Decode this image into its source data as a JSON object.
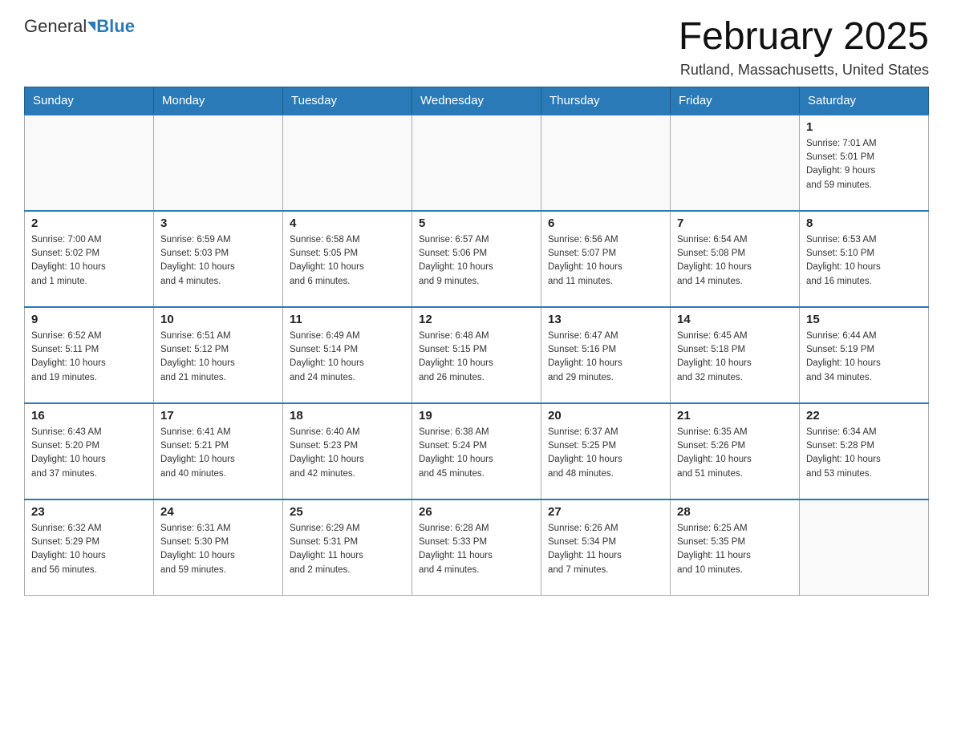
{
  "header": {
    "logo_general": "General",
    "logo_blue": "Blue",
    "month_title": "February 2025",
    "location": "Rutland, Massachusetts, United States"
  },
  "days_of_week": [
    "Sunday",
    "Monday",
    "Tuesday",
    "Wednesday",
    "Thursday",
    "Friday",
    "Saturday"
  ],
  "weeks": [
    [
      {
        "day": "",
        "info": ""
      },
      {
        "day": "",
        "info": ""
      },
      {
        "day": "",
        "info": ""
      },
      {
        "day": "",
        "info": ""
      },
      {
        "day": "",
        "info": ""
      },
      {
        "day": "",
        "info": ""
      },
      {
        "day": "1",
        "info": "Sunrise: 7:01 AM\nSunset: 5:01 PM\nDaylight: 9 hours\nand 59 minutes."
      }
    ],
    [
      {
        "day": "2",
        "info": "Sunrise: 7:00 AM\nSunset: 5:02 PM\nDaylight: 10 hours\nand 1 minute."
      },
      {
        "day": "3",
        "info": "Sunrise: 6:59 AM\nSunset: 5:03 PM\nDaylight: 10 hours\nand 4 minutes."
      },
      {
        "day": "4",
        "info": "Sunrise: 6:58 AM\nSunset: 5:05 PM\nDaylight: 10 hours\nand 6 minutes."
      },
      {
        "day": "5",
        "info": "Sunrise: 6:57 AM\nSunset: 5:06 PM\nDaylight: 10 hours\nand 9 minutes."
      },
      {
        "day": "6",
        "info": "Sunrise: 6:56 AM\nSunset: 5:07 PM\nDaylight: 10 hours\nand 11 minutes."
      },
      {
        "day": "7",
        "info": "Sunrise: 6:54 AM\nSunset: 5:08 PM\nDaylight: 10 hours\nand 14 minutes."
      },
      {
        "day": "8",
        "info": "Sunrise: 6:53 AM\nSunset: 5:10 PM\nDaylight: 10 hours\nand 16 minutes."
      }
    ],
    [
      {
        "day": "9",
        "info": "Sunrise: 6:52 AM\nSunset: 5:11 PM\nDaylight: 10 hours\nand 19 minutes."
      },
      {
        "day": "10",
        "info": "Sunrise: 6:51 AM\nSunset: 5:12 PM\nDaylight: 10 hours\nand 21 minutes."
      },
      {
        "day": "11",
        "info": "Sunrise: 6:49 AM\nSunset: 5:14 PM\nDaylight: 10 hours\nand 24 minutes."
      },
      {
        "day": "12",
        "info": "Sunrise: 6:48 AM\nSunset: 5:15 PM\nDaylight: 10 hours\nand 26 minutes."
      },
      {
        "day": "13",
        "info": "Sunrise: 6:47 AM\nSunset: 5:16 PM\nDaylight: 10 hours\nand 29 minutes."
      },
      {
        "day": "14",
        "info": "Sunrise: 6:45 AM\nSunset: 5:18 PM\nDaylight: 10 hours\nand 32 minutes."
      },
      {
        "day": "15",
        "info": "Sunrise: 6:44 AM\nSunset: 5:19 PM\nDaylight: 10 hours\nand 34 minutes."
      }
    ],
    [
      {
        "day": "16",
        "info": "Sunrise: 6:43 AM\nSunset: 5:20 PM\nDaylight: 10 hours\nand 37 minutes."
      },
      {
        "day": "17",
        "info": "Sunrise: 6:41 AM\nSunset: 5:21 PM\nDaylight: 10 hours\nand 40 minutes."
      },
      {
        "day": "18",
        "info": "Sunrise: 6:40 AM\nSunset: 5:23 PM\nDaylight: 10 hours\nand 42 minutes."
      },
      {
        "day": "19",
        "info": "Sunrise: 6:38 AM\nSunset: 5:24 PM\nDaylight: 10 hours\nand 45 minutes."
      },
      {
        "day": "20",
        "info": "Sunrise: 6:37 AM\nSunset: 5:25 PM\nDaylight: 10 hours\nand 48 minutes."
      },
      {
        "day": "21",
        "info": "Sunrise: 6:35 AM\nSunset: 5:26 PM\nDaylight: 10 hours\nand 51 minutes."
      },
      {
        "day": "22",
        "info": "Sunrise: 6:34 AM\nSunset: 5:28 PM\nDaylight: 10 hours\nand 53 minutes."
      }
    ],
    [
      {
        "day": "23",
        "info": "Sunrise: 6:32 AM\nSunset: 5:29 PM\nDaylight: 10 hours\nand 56 minutes."
      },
      {
        "day": "24",
        "info": "Sunrise: 6:31 AM\nSunset: 5:30 PM\nDaylight: 10 hours\nand 59 minutes."
      },
      {
        "day": "25",
        "info": "Sunrise: 6:29 AM\nSunset: 5:31 PM\nDaylight: 11 hours\nand 2 minutes."
      },
      {
        "day": "26",
        "info": "Sunrise: 6:28 AM\nSunset: 5:33 PM\nDaylight: 11 hours\nand 4 minutes."
      },
      {
        "day": "27",
        "info": "Sunrise: 6:26 AM\nSunset: 5:34 PM\nDaylight: 11 hours\nand 7 minutes."
      },
      {
        "day": "28",
        "info": "Sunrise: 6:25 AM\nSunset: 5:35 PM\nDaylight: 11 hours\nand 10 minutes."
      },
      {
        "day": "",
        "info": ""
      }
    ]
  ]
}
